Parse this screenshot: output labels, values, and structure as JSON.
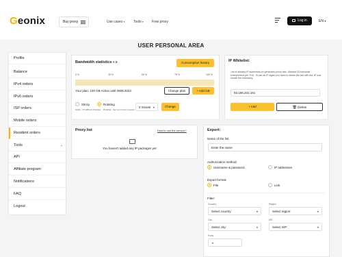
{
  "header": {
    "logo": {
      "accent": "G",
      "rest": "eonix"
    },
    "buy_proxy": "Buy proxy",
    "nav": [
      "Use cases",
      "Tools",
      "Free proxy"
    ],
    "login": "Log in",
    "lang": "EN"
  },
  "page_title": "USER PERSONAL AREA",
  "sidebar": {
    "items": [
      "Profile",
      "Balance",
      "IPv4 orders",
      "IPv6 orders",
      "ISP orders",
      "Mobile orders",
      "Resident orders",
      "Tools",
      "API",
      "Affiliate program",
      "Notifications",
      "FAQ",
      "Logout"
    ],
    "active_index": 6
  },
  "bandwidth": {
    "title": "Bandwidth statistics",
    "value": "0 B",
    "history_button": "Consumption history",
    "ticks": [
      "0 %",
      "25 %",
      "50 %",
      "75 %",
      "100 %"
    ],
    "usage_fraction": 0,
    "plan_text": "Your plan: 100 GB Active until 0908.2023",
    "change_plan": "Change plan",
    "add_gb": "+ Add GB",
    "sticky": "Sticky",
    "sticky_note": "Sticky - IP address changes",
    "rotating": "Rotating",
    "rotating_note": "Rotating - new ip on every request",
    "interval": "5 minute",
    "change_button": "Change"
  },
  "whitelist": {
    "title": "IP Whitelist:",
    "description": "List of allowed IP addresses for generated proxy lists. Allowed 15 individual entrepreneur per TOU. To use an IP again you need to delete the last with this IP unix create the necessary.",
    "ip": "93.186.201.151",
    "add": "+ Add",
    "delete": "Delete"
  },
  "proxy_list": {
    "title": "Proxy list",
    "how_link": "How to use the service?",
    "empty": "You haven't added any IP packages yet"
  },
  "export": {
    "title": "Export:",
    "name_label": "Name of the list",
    "name_placeholder": "Enter the name",
    "auth_label": "Authorization method:",
    "auth_options": [
      "Username & password",
      "IP addresses"
    ],
    "format_label": "Export format:",
    "format_options": [
      "File",
      "Link"
    ],
    "filter_label": "Filter:",
    "country_label": "Country",
    "country_placeholder": "Select country:",
    "region_label": "Region",
    "region_placeholder": "Select region:",
    "city_label": "City",
    "city_placeholder": "Select city:",
    "isp_label": "ISP",
    "isp_placeholder": "Select ISP:",
    "ports_label": "Ports"
  },
  "colors": {
    "accent": "#f9c12f",
    "dark": "#111111",
    "background": "#f4f4f4"
  }
}
